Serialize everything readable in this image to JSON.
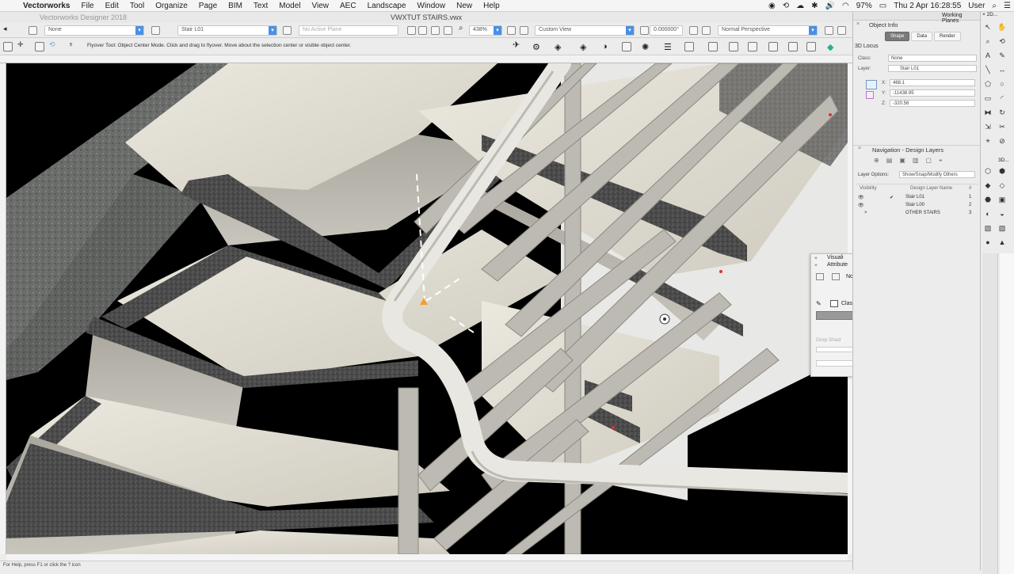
{
  "menubar": {
    "app_name": "Vectorworks",
    "items": [
      "File",
      "Edit",
      "Tool",
      "Organize",
      "Page",
      "BIM",
      "Text",
      "Model",
      "View",
      "AEC",
      "Landscape",
      "Window",
      "New",
      "Help"
    ],
    "battery": "97%",
    "clock": "Thu 2 Apr  16:28:55",
    "user": "User"
  },
  "window": {
    "app_title": "Vectorworks Designer 2018",
    "doc_title": "VWXTUT STAIRS.vwx"
  },
  "viewbar": {
    "class_value": "None",
    "layer_value": "Stair L01",
    "plane_value": "No Active Plane",
    "zoom": "438%",
    "view_value": "Custom View",
    "angle_value": "0.000000°",
    "render_value": "Normal Perspective"
  },
  "modebar": {
    "message": "Flyover Tool: Object Center Mode. Click and drag to flyover.  Move about the selection center or visible object center."
  },
  "status": {
    "help_text": "For Help, press F1 or click the ? icon"
  },
  "object_info": {
    "title": "Object Info",
    "tabs": [
      "Shape",
      "Data",
      "Render"
    ],
    "active_tab": "Shape",
    "object_type": "3D Locus",
    "class_label": "Class:",
    "class_value": "None",
    "layer_label": "Layer:",
    "layer_value": "Stair L01",
    "x_label": "X:",
    "x_value": "468.1",
    "y_label": "Y:",
    "y_value": "-11438.95",
    "z_label": "Z:",
    "z_value": "-320.56"
  },
  "working_planes": {
    "title": "Working Planes"
  },
  "navigation": {
    "title": "Navigation - Design Layers",
    "layer_options_label": "Layer Options:",
    "layer_options_value": "Show/Snap/Modify Others",
    "col_visibility": "Visibility",
    "col_name": "Design Layer Name",
    "col_num": "#",
    "layers": [
      {
        "name": "Stair L01",
        "num": "1"
      },
      {
        "name": "Stair L00",
        "num": "2"
      },
      {
        "name": "OTHER STAIRS",
        "num": "3"
      }
    ]
  },
  "visualization": {
    "title": "Visuali",
    "attributes": "Attribute",
    "class_label": "Clas",
    "drop_shadow": "Drop Shad",
    "none_label": "No"
  },
  "toolpalette": {
    "header": "2D...",
    "header3d": "3D..."
  },
  "colors": {
    "accent": "#4a90e2",
    "menubar_bg": "#f5f5f5",
    "panel_bg": "#ececec",
    "stair_tread": "#d8d4c8",
    "stair_nosing": "#3e3e3e",
    "rail": "#e6e4de"
  }
}
